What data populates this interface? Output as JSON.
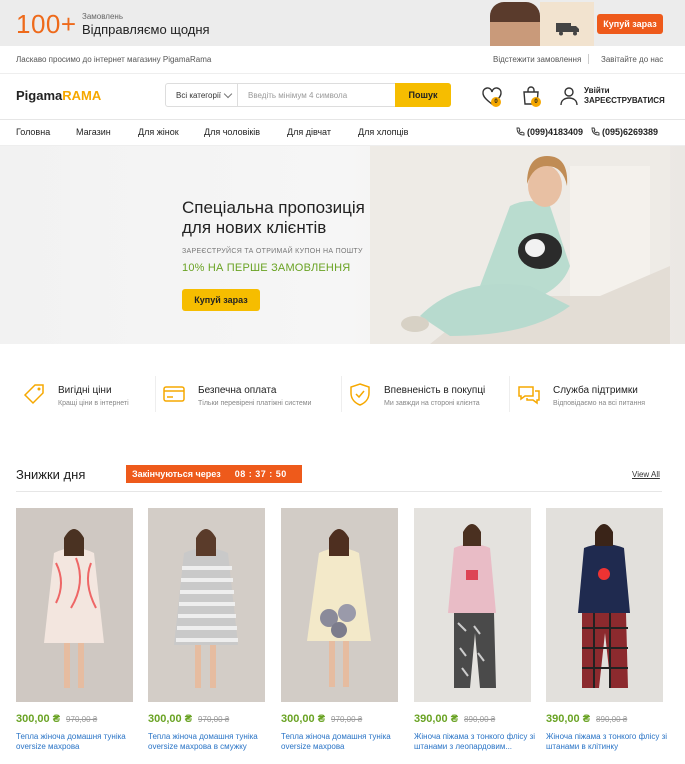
{
  "promo": {
    "count": "100+",
    "small": "Замовлень",
    "main": "Відправляємо щодня",
    "button": "Купуй зараз"
  },
  "welcome": {
    "message": "Ласкаво просимо до інтернет магазину PigamaRama",
    "track": "Відстежити замовлення",
    "invite": "Завітайте до нас"
  },
  "header": {
    "logo_a": "Pigama",
    "logo_b": "RAMA",
    "category": "Всі категорії",
    "search_placeholder": "Введіть мінімум 4 символа",
    "search_button": "Пошук",
    "wishlist_count": "0",
    "cart_count": "0",
    "login": "Увійти",
    "register": "ЗАРЕЄСТРУВАТИСЯ"
  },
  "nav": {
    "items": [
      "Головна",
      "Магазин",
      "Для жінок",
      "Для чоловіків",
      "Для дівчат",
      "Для хлопців"
    ],
    "phone1": "(099)4183409",
    "phone2": "(095)6269389"
  },
  "hero": {
    "title_line1": "Спеціальна пропозиція",
    "title_line2": "для нових клієнтів",
    "subtitle": "ЗАРЕЄСТРУЙСЯ ТА ОТРИМАЙ КУПОН НА ПОШТУ",
    "offer": "10% НА ПЕРШЕ ЗАМОВЛЕННЯ",
    "button": "Купуй зараз"
  },
  "benefits": [
    {
      "icon": "tag-icon",
      "title": "Вигідні ціни",
      "subtitle": "Кращі ціни в інтернеті"
    },
    {
      "icon": "card-icon",
      "title": "Безпечна оплата",
      "subtitle": "Тільки перевірені платіжні системи"
    },
    {
      "icon": "shield-icon",
      "title": "Впевненість в покупці",
      "subtitle": "Ми завжди на стороні клієнта"
    },
    {
      "icon": "chat-icon",
      "title": "Служба підтримки",
      "subtitle": "Відповідаємо на всі питання"
    }
  ],
  "deals": {
    "title": "Знижки дня",
    "timer_label": "Закінчуються через",
    "timer": "08 : 37 : 50",
    "view_all": "View All"
  },
  "products": [
    {
      "price": "300,00 ₴",
      "old_price": "970,00 ₴",
      "name": "Тепла жіноча домашня туніка oversize махрова"
    },
    {
      "price": "300,00 ₴",
      "old_price": "970,00 ₴",
      "name": "Тепла жіноча домашня туніка oversize махрова в смужку"
    },
    {
      "price": "300,00 ₴",
      "old_price": "970,00 ₴",
      "name": "Тепла жіноча домашня туніка oversize махрова"
    },
    {
      "price": "390,00 ₴",
      "old_price": "890,00 ₴",
      "name": "Жіноча піжама з тонкого флісу зі штанами з леопардовим..."
    },
    {
      "price": "390,00 ₴",
      "old_price": "890,00 ₴",
      "name": "Жіноча піжама з тонкого флісу зі штанами в клітинку"
    }
  ],
  "colors": {
    "accent_orange": "#ee5a1b",
    "accent_yellow": "#f6bd00",
    "price_green": "#6aa324",
    "link_blue": "#2a74c6"
  }
}
